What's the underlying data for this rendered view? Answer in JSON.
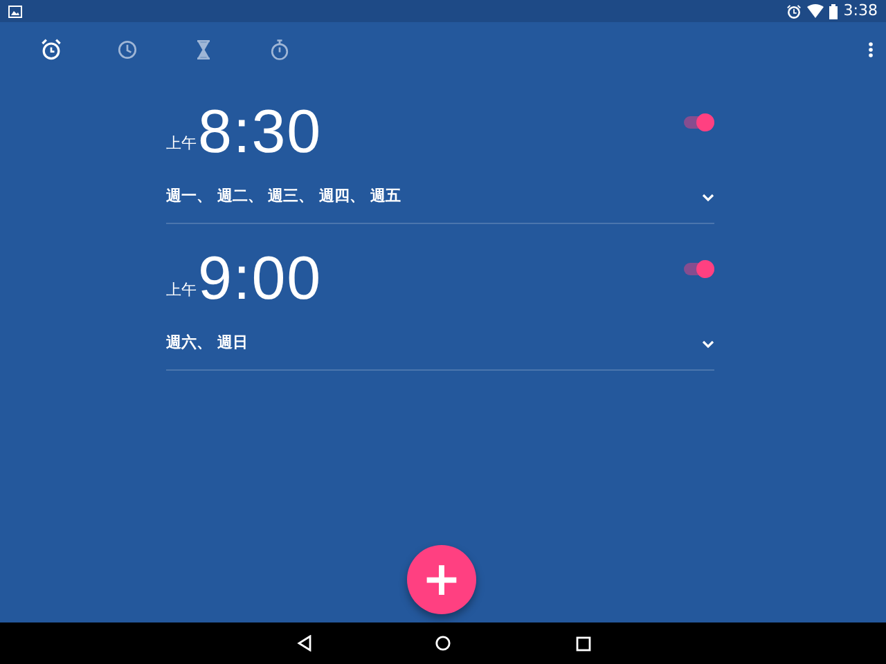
{
  "status_bar": {
    "time": "3:38"
  },
  "tabs": [
    {
      "kind": "alarm",
      "selected": true
    },
    {
      "kind": "clock",
      "selected": false
    },
    {
      "kind": "timer",
      "selected": false
    },
    {
      "kind": "stopwatch",
      "selected": false
    }
  ],
  "alarms": [
    {
      "period": "上午",
      "time": "8:30",
      "days": "週一、 週二、 週三、 週四、 週五",
      "on": true,
      "expanded": false
    },
    {
      "period": "上午",
      "time": "9:00",
      "days": "週六、 週日",
      "on": true,
      "expanded": false
    }
  ],
  "fab": {
    "label": "+"
  }
}
